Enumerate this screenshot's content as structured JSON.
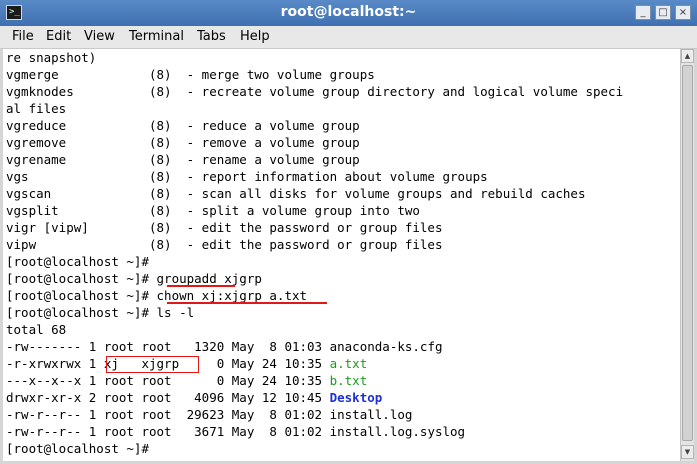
{
  "window": {
    "title": "root@localhost:~"
  },
  "titlebar_buttons": {
    "minimize": "_",
    "maximize": "□",
    "close": "×"
  },
  "menu": [
    "File",
    "Edit",
    "View",
    "Terminal",
    "Tabs",
    "Help"
  ],
  "terminal_lines": [
    "re snapshot)",
    "vgmerge            (8)  - merge two volume groups",
    "vgmknodes          (8)  - recreate volume group directory and logical volume speci",
    "al files",
    "vgreduce           (8)  - reduce a volume group",
    "vgremove           (8)  - remove a volume group",
    "vgrename           (8)  - rename a volume group",
    "vgs                (8)  - report information about volume groups",
    "vgscan             (8)  - scan all disks for volume groups and rebuild caches",
    "vgsplit            (8)  - split a volume group into two",
    "vigr [vipw]        (8)  - edit the password or group files",
    "vipw               (8)  - edit the password or group files",
    "[root@localhost ~]#",
    "[root@localhost ~]# groupadd xjgrp",
    "[root@localhost ~]# chown xj:xjgrp a.txt",
    "[root@localhost ~]# ls -l",
    "total 68"
  ],
  "listing": [
    {
      "meta": "-rw------- 1 root root   1320 May  8 01:03 ",
      "name": "anaconda-ks.cfg",
      "style": ""
    },
    {
      "meta": "-r-xrwxrwx 1 xj   xjgrp     0 May 24 10:35 ",
      "name": "a.txt",
      "style": "green"
    },
    {
      "meta": "---x--x--x 1 root root      0 May 24 10:35 ",
      "name": "b.txt",
      "style": "green"
    },
    {
      "meta": "drwxr-xr-x 2 root root   4096 May 12 10:45 ",
      "name": "Desktop",
      "style": "blue"
    },
    {
      "meta": "-rw-r--r-- 1 root root  29623 May  8 01:02 ",
      "name": "install.log",
      "style": ""
    },
    {
      "meta": "-rw-r--r-- 1 root root   3671 May  8 01:02 ",
      "name": "install.log.syslog",
      "style": ""
    }
  ],
  "final_prompt": "[root@localhost ~]#",
  "colors": {
    "title_bar": "#4a7cbf",
    "highlight": "#e01818",
    "executable": "#1d9a1d",
    "directory": "#1f2fd6"
  }
}
